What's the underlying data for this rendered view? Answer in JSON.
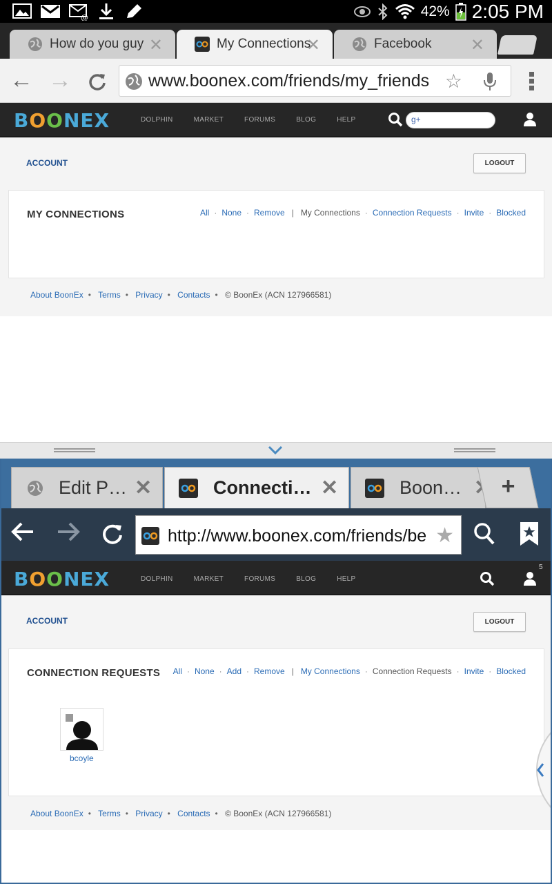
{
  "status_bar": {
    "battery": "42%",
    "time": "2:05 PM",
    "icons": [
      "image-icon",
      "gmail-icon",
      "email-alert-icon",
      "download-icon",
      "edit-icon",
      "eye-icon",
      "bluetooth-icon",
      "wifi-icon",
      "battery-charging-icon"
    ]
  },
  "top_browser": {
    "tabs": [
      {
        "label": "How do you guy",
        "icon": "globe-icon"
      },
      {
        "label": "My Connections",
        "icon": "boonex-favicon",
        "active": true
      },
      {
        "label": "Facebook",
        "icon": "globe-icon"
      }
    ],
    "url": "www.boonex.com/friends/my_friends"
  },
  "top_page": {
    "logo": {
      "b": "B",
      "o1": "O",
      "o2": "O",
      "rest": "NEX"
    },
    "nav": [
      "DOLPHIN",
      "MARKET",
      "FORUMS",
      "BLOG",
      "HELP"
    ],
    "search_hint": "g+",
    "account": "ACCOUNT",
    "logout": "LOGOUT",
    "card_title": "MY CONNECTIONS",
    "links": {
      "all": "All",
      "none": "None",
      "remove": "Remove",
      "my_connections": "My Connections",
      "connection_requests": "Connection Requests",
      "invite": "Invite",
      "blocked": "Blocked"
    },
    "footer": {
      "about": "About BoonEx",
      "terms": "Terms",
      "privacy": "Privacy",
      "contacts": "Contacts",
      "copyright": "© BoonEx (ACN 127966581)"
    }
  },
  "bottom_browser": {
    "tabs": [
      {
        "label": "Edit P…",
        "icon": "globe-icon"
      },
      {
        "label": "Connecti…",
        "icon": "boonex-favicon",
        "active": true
      },
      {
        "label": "Boon…",
        "icon": "boonex-favicon"
      }
    ],
    "new_tab": "+",
    "url": "http://www.boonex.com/friends/be"
  },
  "bottom_page": {
    "logo": {
      "b": "B",
      "o1": "O",
      "o2": "O",
      "rest": "NEX"
    },
    "nav": [
      "DOLPHIN",
      "MARKET",
      "FORUMS",
      "BLOG",
      "HELP"
    ],
    "notification_count": "5",
    "account": "ACCOUNT",
    "logout": "LOGOUT",
    "card_title": "CONNECTION REQUESTS",
    "links": {
      "all": "All",
      "none": "None",
      "add": "Add",
      "remove": "Remove",
      "my_connections": "My Connections",
      "connection_requests": "Connection Requests",
      "invite": "Invite",
      "blocked": "Blocked"
    },
    "member": {
      "name": "bcoyle"
    },
    "footer": {
      "about": "About BoonEx",
      "terms": "Terms",
      "privacy": "Privacy",
      "contacts": "Contacts",
      "copyright": "© BoonEx (ACN 127966581)"
    }
  }
}
